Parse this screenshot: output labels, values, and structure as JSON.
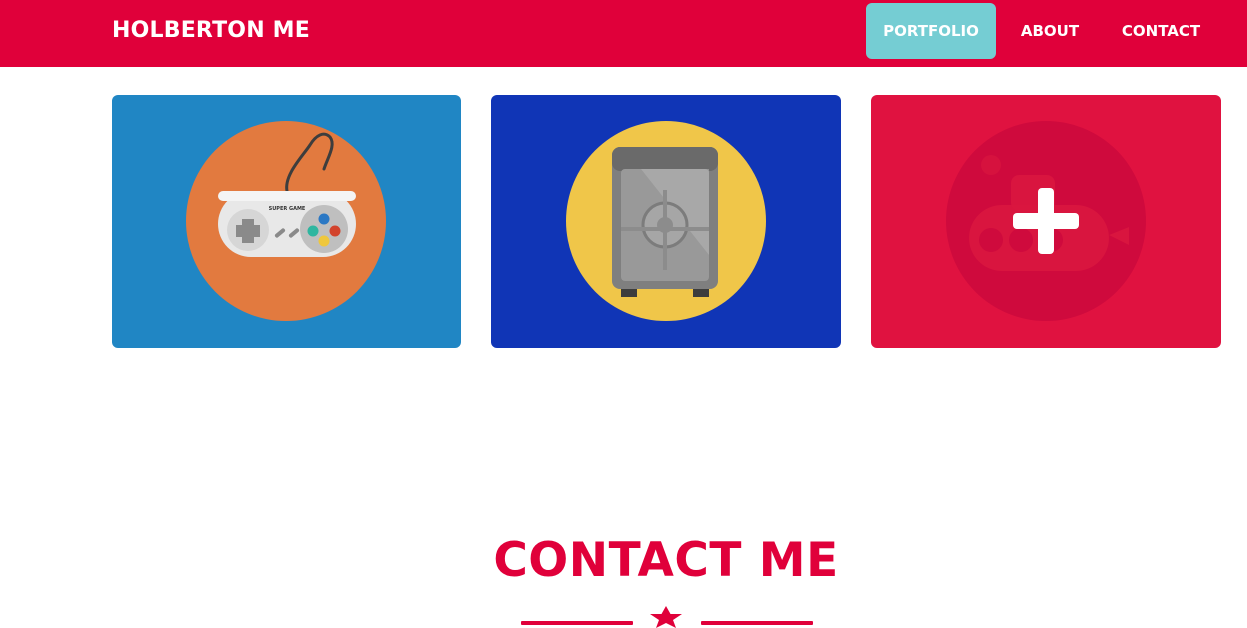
{
  "navbar": {
    "brand": "HOLBERTON ME",
    "links": [
      "PORTFOLIO",
      "ABOUT",
      "CONTACT"
    ],
    "active_link": "PORTFOLIO",
    "background_color": "#e0003a",
    "active_color": "#75cdd3"
  },
  "portfolio": {
    "cards": [
      {
        "icon": "game-controller-icon",
        "background_color": "#2086c4",
        "circle_color": "#e27a3f",
        "controller_text": "SUPER GAME"
      },
      {
        "icon": "safe-icon",
        "background_color": "#1035b6",
        "circle_color": "#f0c649"
      },
      {
        "icon": "submarine-icon",
        "background_color": "#e01240",
        "overlay": "plus-icon"
      }
    ]
  },
  "contact": {
    "heading": "CONTACT ME",
    "accent_color": "#e0003a",
    "divider_icon": "star-icon"
  }
}
